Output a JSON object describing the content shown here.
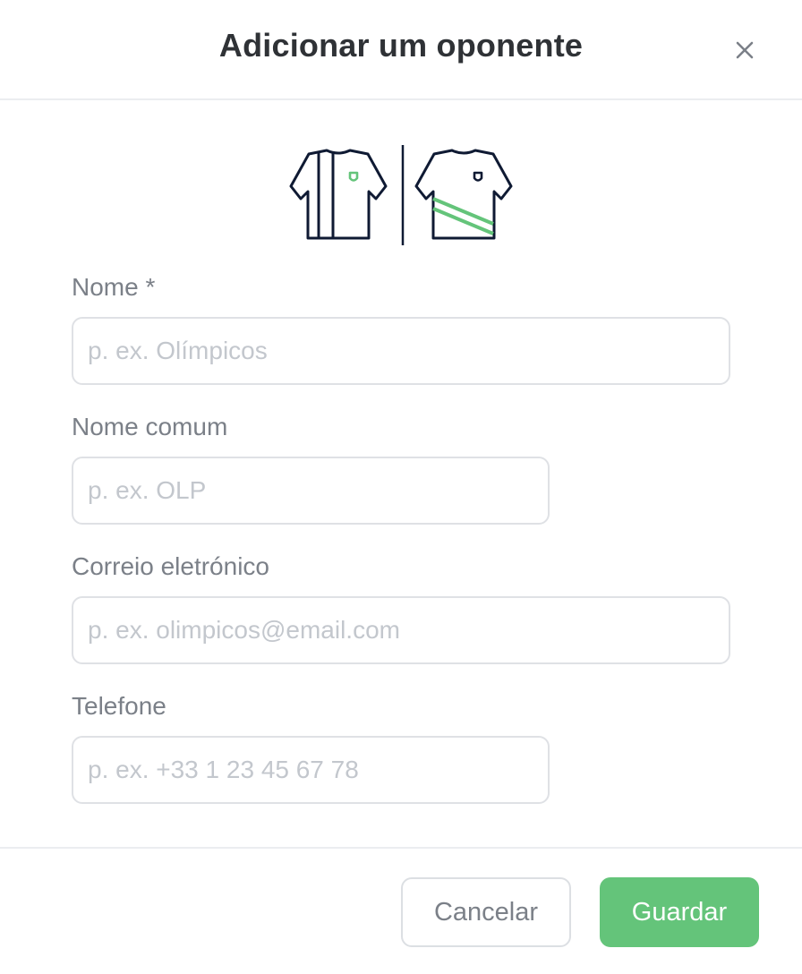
{
  "dialog": {
    "title": "Adicionar um oponente",
    "close_icon": "close-icon"
  },
  "jerseys": {
    "home_icon": "striped-jersey-icon",
    "away_icon": "sash-jersey-icon",
    "colors": {
      "outline": "#0f1a33",
      "accent": "#64c47a"
    }
  },
  "form": {
    "name": {
      "label": "Nome *",
      "placeholder": "p. ex. Olímpicos",
      "value": ""
    },
    "short_name": {
      "label": "Nome comum",
      "placeholder": "p. ex. OLP",
      "value": ""
    },
    "email": {
      "label": "Correio eletrónico",
      "placeholder": "p. ex. olimpicos@email.com",
      "value": ""
    },
    "phone": {
      "label": "Telefone",
      "placeholder": "p. ex. +33 1 23 45 67 78",
      "value": ""
    }
  },
  "footer": {
    "cancel_label": "Cancelar",
    "save_label": "Guardar",
    "save_color": "#64c47a"
  }
}
